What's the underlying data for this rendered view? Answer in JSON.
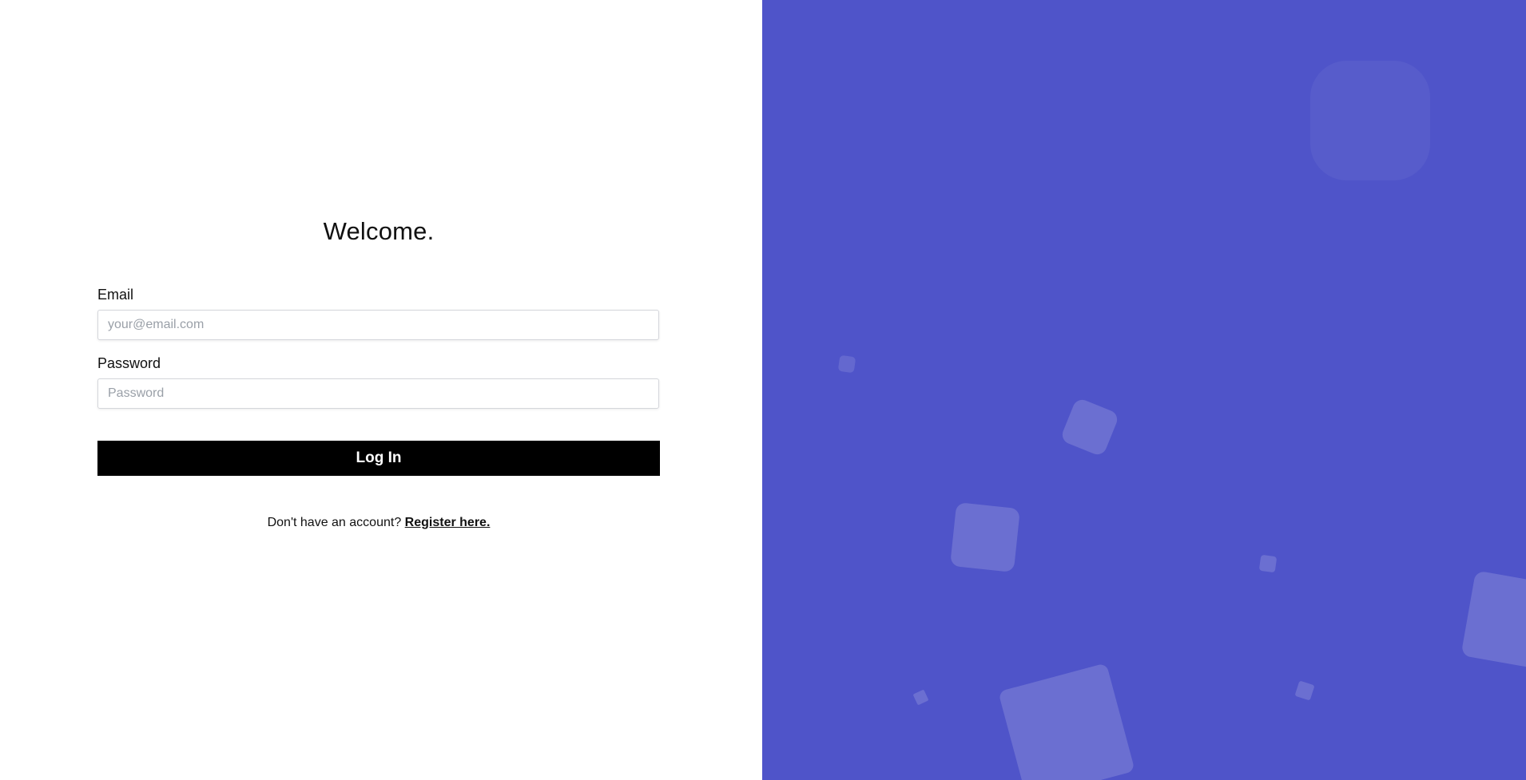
{
  "login": {
    "title": "Welcome.",
    "email_label": "Email",
    "email_placeholder": "your@email.com",
    "password_label": "Password",
    "password_placeholder": "Password",
    "submit_label": "Log In",
    "register_prompt": "Don't have an account?",
    "register_link": "Register here."
  },
  "theme": {
    "panel_color": "#4f54c9",
    "button_color": "#000000"
  }
}
